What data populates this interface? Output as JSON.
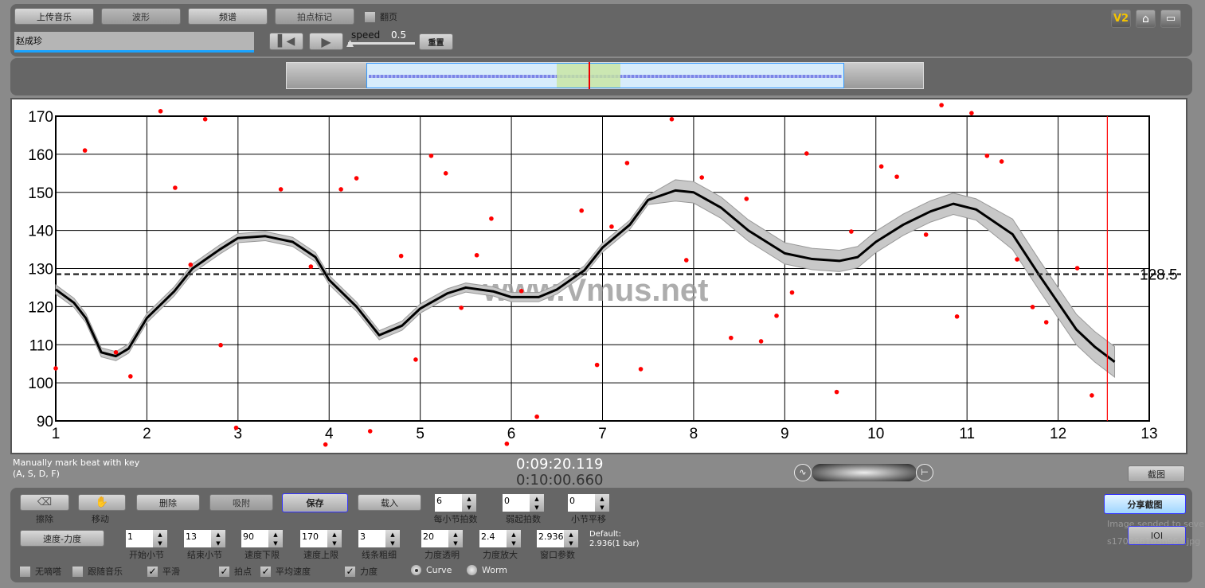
{
  "toolbar": {
    "upload": "上传音乐",
    "waveform": "波形",
    "spectrum": "频谱",
    "beat_mark": "拍点标记",
    "page_flip": "翻页",
    "title_value": "赵成珍",
    "speed_label": "speed",
    "speed_value": "0.5",
    "reset": "重置",
    "speed_fraction": 0.0,
    "v2": "V2"
  },
  "icons": {
    "home": "home-icon",
    "screen": "screen-icon",
    "prev": "skip-back-icon",
    "play": "play-icon"
  },
  "chart_data": {
    "type": "line",
    "xlim": [
      1,
      13
    ],
    "ylim": [
      90,
      170
    ],
    "x_ticks": [
      "1",
      "2",
      "3",
      "4",
      "5",
      "6",
      "7",
      "8",
      "9",
      "10",
      "11",
      "12",
      "13"
    ],
    "y_ticks": [
      "90",
      "100",
      "110",
      "120",
      "130",
      "140",
      "150",
      "160",
      "170"
    ],
    "grid": true,
    "average": 128.5,
    "average_label": "128.5",
    "cursor_x": 12.54,
    "watermark": "www.Vmus.net",
    "smooth_curve": [
      [
        1.0,
        124.5
      ],
      [
        1.2,
        121
      ],
      [
        1.33,
        117
      ],
      [
        1.5,
        108
      ],
      [
        1.66,
        107
      ],
      [
        1.8,
        109
      ],
      [
        2.0,
        117
      ],
      [
        2.3,
        124
      ],
      [
        2.5,
        130
      ],
      [
        2.8,
        135
      ],
      [
        3.0,
        138
      ],
      [
        3.3,
        138.5
      ],
      [
        3.6,
        137
      ],
      [
        3.85,
        133
      ],
      [
        4.0,
        127
      ],
      [
        4.3,
        120
      ],
      [
        4.55,
        112.5
      ],
      [
        4.8,
        115
      ],
      [
        5.0,
        119.5
      ],
      [
        5.3,
        123.5
      ],
      [
        5.5,
        125
      ],
      [
        5.8,
        124
      ],
      [
        6.0,
        122.5
      ],
      [
        6.3,
        122.5
      ],
      [
        6.5,
        124.5
      ],
      [
        6.8,
        129.5
      ],
      [
        7.0,
        135.5
      ],
      [
        7.3,
        141.5
      ],
      [
        7.5,
        148
      ],
      [
        7.8,
        150.5
      ],
      [
        8.0,
        150
      ],
      [
        8.3,
        146
      ],
      [
        8.6,
        140
      ],
      [
        9.0,
        134
      ],
      [
        9.3,
        132.5
      ],
      [
        9.6,
        132
      ],
      [
        9.8,
        133
      ],
      [
        10.0,
        137
      ],
      [
        10.3,
        141.5
      ],
      [
        10.6,
        145
      ],
      [
        10.85,
        147
      ],
      [
        11.1,
        145.5
      ],
      [
        11.5,
        139
      ],
      [
        11.8,
        128
      ],
      [
        12.0,
        121
      ],
      [
        12.2,
        114
      ],
      [
        12.4,
        109.5
      ],
      [
        12.62,
        105.5
      ]
    ],
    "beat_points": [
      [
        1.0,
        103.8
      ],
      [
        1.32,
        161.0
      ],
      [
        1.66,
        108.0
      ],
      [
        1.82,
        101.7
      ],
      [
        2.15,
        171.3
      ],
      [
        2.31,
        151.2
      ],
      [
        2.48,
        131.0
      ],
      [
        2.64,
        169.2
      ],
      [
        2.81,
        109.9
      ],
      [
        2.98,
        88.2
      ],
      [
        3.47,
        150.8
      ],
      [
        3.8,
        130.5
      ],
      [
        3.96,
        83.8
      ],
      [
        4.13,
        150.8
      ],
      [
        4.3,
        153.7
      ],
      [
        4.45,
        87.3
      ],
      [
        4.79,
        133.3
      ],
      [
        4.95,
        106.1
      ],
      [
        5.12,
        159.6
      ],
      [
        5.28,
        155.0
      ],
      [
        5.45,
        119.7
      ],
      [
        5.62,
        133.5
      ],
      [
        5.78,
        143.1
      ],
      [
        5.95,
        84.0
      ],
      [
        6.11,
        124.1
      ],
      [
        6.28,
        91.1
      ],
      [
        6.77,
        145.2
      ],
      [
        6.94,
        104.7
      ],
      [
        7.1,
        141.0
      ],
      [
        7.27,
        157.7
      ],
      [
        7.42,
        103.6
      ],
      [
        7.76,
        169.2
      ],
      [
        7.92,
        132.2
      ],
      [
        8.09,
        153.9
      ],
      [
        8.41,
        111.8
      ],
      [
        8.58,
        148.3
      ],
      [
        8.74,
        110.9
      ],
      [
        8.91,
        117.6
      ],
      [
        9.08,
        123.7
      ],
      [
        9.24,
        160.2
      ],
      [
        9.57,
        97.6
      ],
      [
        9.73,
        139.7
      ],
      [
        10.06,
        156.8
      ],
      [
        10.23,
        154.1
      ],
      [
        10.55,
        138.9
      ],
      [
        10.72,
        172.9
      ],
      [
        10.89,
        117.4
      ],
      [
        11.05,
        170.8
      ],
      [
        11.22,
        159.6
      ],
      [
        11.38,
        158.1
      ],
      [
        11.55,
        132.4
      ],
      [
        11.72,
        119.9
      ],
      [
        11.87,
        115.9
      ],
      [
        12.21,
        130.1
      ],
      [
        12.37,
        96.7
      ]
    ],
    "colors": {
      "curve": "#000000",
      "band": "#c8c8c8",
      "points": "#ff0000",
      "cursor": "#ff0000"
    }
  },
  "status": {
    "hint1": "Manually mark beat with key",
    "hint2": "(A, S, D, F)",
    "time_current": "0:09:20.119",
    "time_total": "0:10:00.660",
    "screenshot": "截图"
  },
  "controls": {
    "erase": "擦除",
    "move": "移动",
    "delete": "删除",
    "snap": "吸附",
    "save": "保存",
    "load": "载入",
    "tempo_dynamics": "速度-力度",
    "spinners": [
      {
        "label": "每小节拍数",
        "value": "6"
      },
      {
        "label": "弱起拍数",
        "value": "0"
      },
      {
        "label": "小节平移",
        "value": "0"
      },
      {
        "label": "开始小节",
        "value": "1"
      },
      {
        "label": "结束小节",
        "value": "13"
      },
      {
        "label": "速度下限",
        "value": "90"
      },
      {
        "label": "速度上限",
        "value": "170"
      },
      {
        "label": "线条粗细",
        "value": "3"
      },
      {
        "label": "力度透明",
        "value": "20"
      },
      {
        "label": "力度放大",
        "value": "2.4"
      },
      {
        "label": "窗口参数",
        "value": "2.936"
      }
    ],
    "default_label": "Default:",
    "default_value": "2.936(1 bar)",
    "checks": [
      {
        "label": "无嘀嗒",
        "checked": false
      },
      {
        "label": "跟随音乐",
        "checked": false
      },
      {
        "label": "平滑",
        "checked": true
      },
      {
        "label": "拍点",
        "checked": true
      },
      {
        "label": "平均速度",
        "checked": true
      },
      {
        "label": "力度",
        "checked": true
      }
    ],
    "radios": [
      {
        "label": "Curve",
        "selected": true
      },
      {
        "label": "Worm",
        "selected": false
      }
    ],
    "share": "分享截图",
    "ioi": "IOI",
    "sent_msg": "Image sended to sever",
    "file_name": "s1708661b3n964.jpg"
  }
}
